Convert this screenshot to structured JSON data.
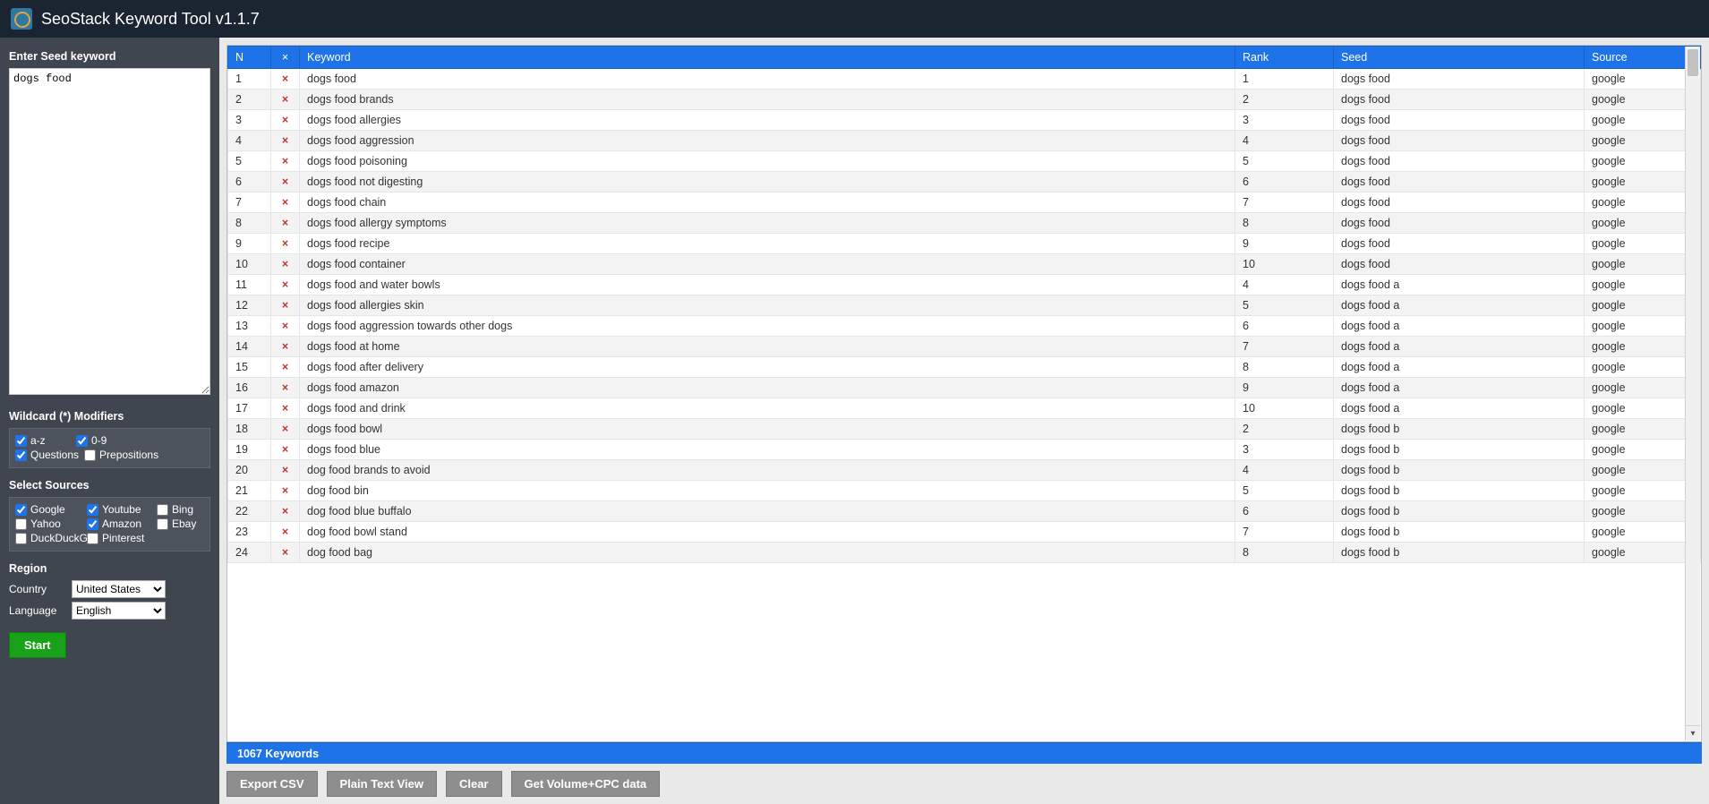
{
  "app": {
    "title": "SeoStack Keyword Tool v1.1.7"
  },
  "sidebar": {
    "seed_label": "Enter Seed keyword",
    "seed_value": "dogs food",
    "wildcard_label": "Wildcard (*) Modifiers",
    "wildcard_options": [
      {
        "label": "a-z",
        "checked": true
      },
      {
        "label": "0-9",
        "checked": true
      },
      {
        "label": "Questions",
        "checked": true
      },
      {
        "label": "Prepositions",
        "checked": false
      }
    ],
    "sources_label": "Select Sources",
    "sources": [
      {
        "label": "Google",
        "checked": true
      },
      {
        "label": "Youtube",
        "checked": true
      },
      {
        "label": "Bing",
        "checked": false
      },
      {
        "label": "Yahoo",
        "checked": false
      },
      {
        "label": "Amazon",
        "checked": true
      },
      {
        "label": "Ebay",
        "checked": false
      },
      {
        "label": "DuckDuckGo",
        "checked": false
      },
      {
        "label": "Pinterest",
        "checked": false
      }
    ],
    "region_label": "Region",
    "country_label": "Country",
    "country_value": "United States",
    "language_label": "Language",
    "language_value": "English",
    "start_label": "Start"
  },
  "table": {
    "headers": {
      "n": "N",
      "x": "×",
      "keyword": "Keyword",
      "rank": "Rank",
      "seed": "Seed",
      "source": "Source"
    },
    "rows": [
      {
        "n": 1,
        "keyword": "dogs food",
        "rank": 1,
        "seed": "dogs food",
        "source": "google"
      },
      {
        "n": 2,
        "keyword": "dogs food brands",
        "rank": 2,
        "seed": "dogs food",
        "source": "google"
      },
      {
        "n": 3,
        "keyword": "dogs food allergies",
        "rank": 3,
        "seed": "dogs food",
        "source": "google"
      },
      {
        "n": 4,
        "keyword": "dogs food aggression",
        "rank": 4,
        "seed": "dogs food",
        "source": "google"
      },
      {
        "n": 5,
        "keyword": "dogs food poisoning",
        "rank": 5,
        "seed": "dogs food",
        "source": "google"
      },
      {
        "n": 6,
        "keyword": "dogs food not digesting",
        "rank": 6,
        "seed": "dogs food",
        "source": "google"
      },
      {
        "n": 7,
        "keyword": "dogs food chain",
        "rank": 7,
        "seed": "dogs food",
        "source": "google"
      },
      {
        "n": 8,
        "keyword": "dogs food allergy symptoms",
        "rank": 8,
        "seed": "dogs food",
        "source": "google"
      },
      {
        "n": 9,
        "keyword": "dogs food recipe",
        "rank": 9,
        "seed": "dogs food",
        "source": "google"
      },
      {
        "n": 10,
        "keyword": "dogs food container",
        "rank": 10,
        "seed": "dogs food",
        "source": "google"
      },
      {
        "n": 11,
        "keyword": "dogs food and water bowls",
        "rank": 4,
        "seed": "dogs food a",
        "source": "google"
      },
      {
        "n": 12,
        "keyword": "dogs food allergies skin",
        "rank": 5,
        "seed": "dogs food a",
        "source": "google"
      },
      {
        "n": 13,
        "keyword": "dogs food aggression towards other dogs",
        "rank": 6,
        "seed": "dogs food a",
        "source": "google"
      },
      {
        "n": 14,
        "keyword": "dogs food at home",
        "rank": 7,
        "seed": "dogs food a",
        "source": "google"
      },
      {
        "n": 15,
        "keyword": "dogs food after delivery",
        "rank": 8,
        "seed": "dogs food a",
        "source": "google"
      },
      {
        "n": 16,
        "keyword": "dogs food amazon",
        "rank": 9,
        "seed": "dogs food a",
        "source": "google"
      },
      {
        "n": 17,
        "keyword": "dogs food and drink",
        "rank": 10,
        "seed": "dogs food a",
        "source": "google"
      },
      {
        "n": 18,
        "keyword": "dogs food bowl",
        "rank": 2,
        "seed": "dogs food b",
        "source": "google"
      },
      {
        "n": 19,
        "keyword": "dogs food blue",
        "rank": 3,
        "seed": "dogs food b",
        "source": "google"
      },
      {
        "n": 20,
        "keyword": "dog food brands to avoid",
        "rank": 4,
        "seed": "dogs food b",
        "source": "google"
      },
      {
        "n": 21,
        "keyword": "dog food bin",
        "rank": 5,
        "seed": "dogs food b",
        "source": "google"
      },
      {
        "n": 22,
        "keyword": "dog food blue buffalo",
        "rank": 6,
        "seed": "dogs food b",
        "source": "google"
      },
      {
        "n": 23,
        "keyword": "dog food bowl stand",
        "rank": 7,
        "seed": "dogs food b",
        "source": "google"
      },
      {
        "n": 24,
        "keyword": "dog food bag",
        "rank": 8,
        "seed": "dogs food b",
        "source": "google"
      }
    ]
  },
  "status": {
    "text": "1067 Keywords"
  },
  "buttons": {
    "export_csv": "Export CSV",
    "plain_text": "Plain Text View",
    "clear": "Clear",
    "volume": "Get Volume+CPC data"
  }
}
